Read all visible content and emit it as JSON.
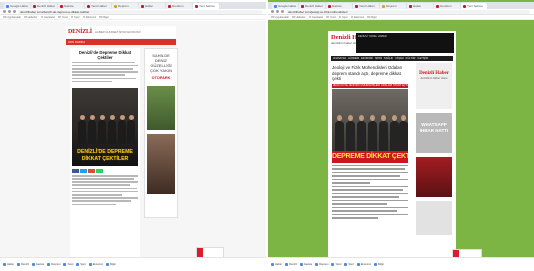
{
  "left_screenshot": {
    "tabs": [
      {
        "label": "Google Haberler"
      },
      {
        "label": "Denizli Haber"
      },
      {
        "label": "Gazete"
      },
      {
        "label": "Yerel Haber"
      },
      {
        "label": "Deprem"
      },
      {
        "label": "Haber"
      },
      {
        "label": "Gundem"
      },
      {
        "label": "Yeni Sekme"
      }
    ],
    "active_tab_index": 7,
    "url": "denizlihaber.com/denizli-de-deprem-e-dikkat-cektiler",
    "bookmarks": [
      "Uygulamalar",
      "Haberler",
      "Gazeteler",
      "Yerel",
      "Spor",
      "Ekonomi",
      "Diğer"
    ],
    "site": {
      "logo": "DENİZLİ",
      "menu": "HABER GÜNDEM SPOR EKONOMİ",
      "redbar": "SON DAKİKA",
      "headline": "Denizli'de Depreme Dikkat Çektiler",
      "photo_caption_line1": "DENİZLİ'DE DEPREME",
      "photo_caption_line2": "DİKKAT ÇEKTİLER",
      "ad_title": "SAHİLDE DENİZ GÜZELLİĞİ ÇOK YAKIN",
      "ad_logo": "OTOPARK"
    },
    "taskbar_items": [
      "Haber",
      "Denizli",
      "Gazete",
      "Deprem",
      "Yerel",
      "Spor",
      "Ekonomi",
      "Diğer"
    ]
  },
  "right_screenshot": {
    "tabs": [
      {
        "label": "Google Haberler"
      },
      {
        "label": "Denizli Haber"
      },
      {
        "label": "Gazete"
      },
      {
        "label": "Yerel Haber"
      },
      {
        "label": "Deprem"
      },
      {
        "label": "Haber"
      },
      {
        "label": "Gundem"
      },
      {
        "label": "Yeni Sekme"
      }
    ],
    "active_tab_index": 7,
    "url": "denizlihaber.com/jeoloji-ve-fizik-muhendisleri",
    "bookmarks": [
      "Uygulamalar",
      "Haberler",
      "Gazeteler",
      "Yerel",
      "Spor",
      "Ekonomi",
      "Diğer"
    ],
    "site": {
      "logo": "Denizli Haber",
      "logo_sub": "denizlinin haber sitesi",
      "banner_text": "DENİZLİ YEREL HABER",
      "nav_items": [
        "ANASAYFA",
        "GÜNDEM",
        "EKONOMİ",
        "SPOR",
        "SAĞLIK",
        "YAŞAM",
        "KÜLTÜR",
        "İLETİŞİM"
      ],
      "headline": "Jeoloji ve Fizik Mühendisleri Odaları deprem standı açtı, depreme dikkat çekti",
      "red_strip": "JEOLOJİ VE JEOFİZİK MÜHENDİSLERİ ODALARI STANT AÇTI",
      "photo_caption": "DEPREME DİKKAT ÇEKTİ",
      "side_logo": "Denizli Haber",
      "side_logo_sub": "denizlinin haber sitesi",
      "side_box2": "WHATSAPP İHBAR HATTI"
    },
    "taskbar_items": [
      "Haber",
      "Denizli",
      "Gazete",
      "Deprem",
      "Yerel",
      "Spor",
      "Ekonomi",
      "Diğer"
    ]
  },
  "colors": {
    "brand_red": "#c8171e",
    "right_background_green": "#7db544",
    "caption_yellow": "#f0c419"
  }
}
